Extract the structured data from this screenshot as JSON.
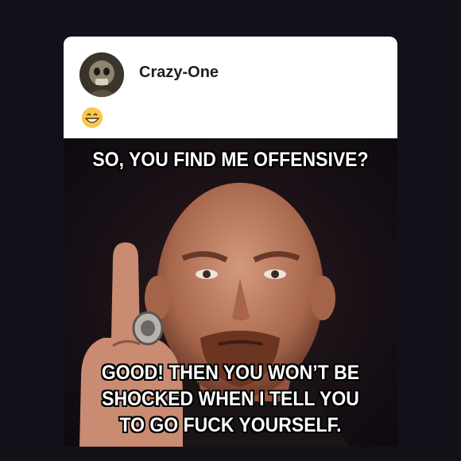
{
  "post": {
    "author": {
      "name": "Crazy-One",
      "avatar_icon": "avatar-skull-icon"
    },
    "reaction_emoji": "grinning-face-icon"
  },
  "meme": {
    "top_caption": "SO, YOU FIND ME OFFENSIVE?",
    "bottom_caption": [
      "GOOD! THEN YOU WON’T BE",
      "SHOCKED WHEN I TELL YOU",
      "TO GO FUCK YOURSELF."
    ]
  },
  "colors": {
    "page_bg": "#14101a",
    "card_bg": "#ffffff",
    "caption_text": "#ffffff"
  }
}
